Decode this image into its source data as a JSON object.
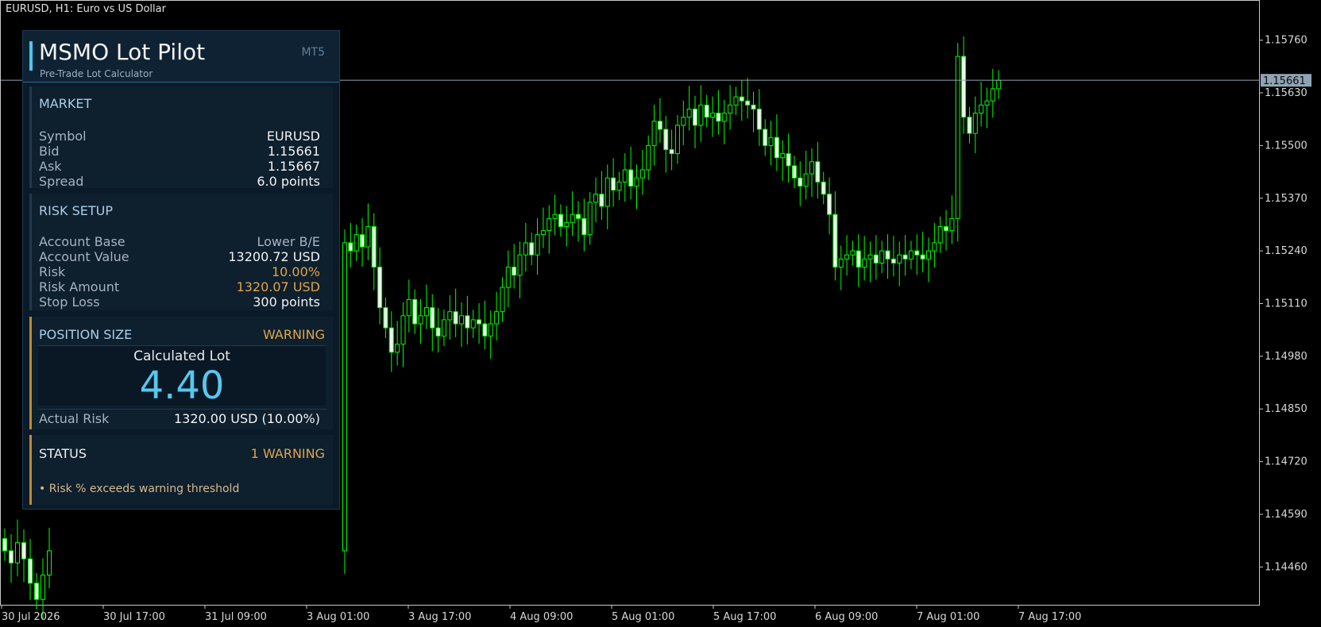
{
  "chart": {
    "title": "EURUSD, H1:  Euro vs US Dollar",
    "current_price": "1.15661",
    "price_labels": [
      "1.15760",
      "1.15630",
      "1.15500",
      "1.15370",
      "1.15240",
      "1.15110",
      "1.14980",
      "1.14850",
      "1.14720",
      "1.14590",
      "1.14460"
    ],
    "price_values": [
      1.1576,
      1.1563,
      1.155,
      1.1537,
      1.1524,
      1.1511,
      1.1498,
      1.1485,
      1.1472,
      1.1459,
      1.1446
    ],
    "time_labels": [
      "30 Jul 2026",
      "30 Jul 17:00",
      "31 Jul 09:00",
      "3 Aug 01:00",
      "3 Aug 17:00",
      "4 Aug 09:00",
      "5 Aug 01:00",
      "5 Aug 17:00",
      "6 Aug 09:00",
      "7 Aug 01:00",
      "7 Aug 17:00"
    ],
    "candle_color": "#00ff00",
    "price_line_color": "#8fa3b5"
  },
  "chart_data": {
    "type": "candlestick",
    "symbol": "EURUSD",
    "timeframe": "H1",
    "ylim": [
      1.144,
      1.1582
    ],
    "last_price": 1.15661,
    "closes": [
      1.145,
      1.1447,
      1.1452,
      1.1448,
      1.1442,
      1.1438,
      1.1444,
      1.145,
      1.1526,
      1.1524,
      1.1528,
      1.1525,
      1.153,
      1.152,
      1.151,
      1.1505,
      1.1499,
      1.1501,
      1.1508,
      1.1512,
      1.1506,
      1.1508,
      1.151,
      1.1505,
      1.1503,
      1.1507,
      1.1509,
      1.1506,
      1.1508,
      1.1505,
      1.1507,
      1.1506,
      1.1503,
      1.1506,
      1.1509,
      1.1515,
      1.152,
      1.1518,
      1.1523,
      1.1526,
      1.1523,
      1.1528,
      1.1529,
      1.1532,
      1.1533,
      1.153,
      1.1531,
      1.1533,
      1.1532,
      1.1528,
      1.1536,
      1.1538,
      1.1535,
      1.1542,
      1.1539,
      1.1541,
      1.1544,
      1.154,
      1.1542,
      1.1544,
      1.155,
      1.1556,
      1.1554,
      1.1549,
      1.1548,
      1.1555,
      1.1557,
      1.1559,
      1.1555,
      1.156,
      1.1557,
      1.1558,
      1.1556,
      1.1558,
      1.156,
      1.1562,
      1.1561,
      1.156,
      1.1559,
      1.1554,
      1.155,
      1.1552,
      1.1547,
      1.1548,
      1.1545,
      1.1542,
      1.154,
      1.1543,
      1.1546,
      1.1541,
      1.1538,
      1.1533,
      1.152,
      1.1522,
      1.1523,
      1.1524,
      1.152,
      1.1522,
      1.1523,
      1.1521,
      1.1524,
      1.1522,
      1.1521,
      1.1523,
      1.1522,
      1.1524,
      1.1523,
      1.1522,
      1.1524,
      1.1526,
      1.153,
      1.1529,
      1.1532,
      1.1572,
      1.1557,
      1.1553,
      1.1558,
      1.156,
      1.1561,
      1.1564,
      1.15661
    ]
  },
  "panel": {
    "title": "MSMO Lot Pilot",
    "subtitle": "Pre-Trade Lot Calculator",
    "tag": "MT5",
    "market": {
      "heading": "MARKET",
      "rows": [
        {
          "label": "Symbol",
          "value": "EURUSD"
        },
        {
          "label": "Bid",
          "value": "1.15661"
        },
        {
          "label": "Ask",
          "value": "1.15667"
        },
        {
          "label": "Spread",
          "value": "6.0 points"
        }
      ]
    },
    "risk": {
      "heading": "RISK SETUP",
      "rows": [
        {
          "label": "Account Base",
          "value": "Lower B/E"
        },
        {
          "label": "Account Value",
          "value": "13200.72 USD"
        },
        {
          "label": "Risk",
          "value": "10.00%"
        },
        {
          "label": "Risk Amount",
          "value": "1320.07 USD"
        },
        {
          "label": "Stop Loss",
          "value": "300 points"
        }
      ]
    },
    "position": {
      "heading": "POSITION SIZE",
      "flag": "WARNING",
      "lot_caption": "Calculated Lot",
      "lot_value": "4.40",
      "actual_risk_label": "Actual Risk",
      "actual_risk_value": "1320.00 USD (10.00%)"
    },
    "status": {
      "heading": "STATUS",
      "flag": "1 WARNING",
      "message": "• Risk % exceeds warning threshold"
    },
    "colors": {
      "accent": "#4ec6ef",
      "warning": "#e0a44a",
      "background": "#0b1a28"
    }
  }
}
